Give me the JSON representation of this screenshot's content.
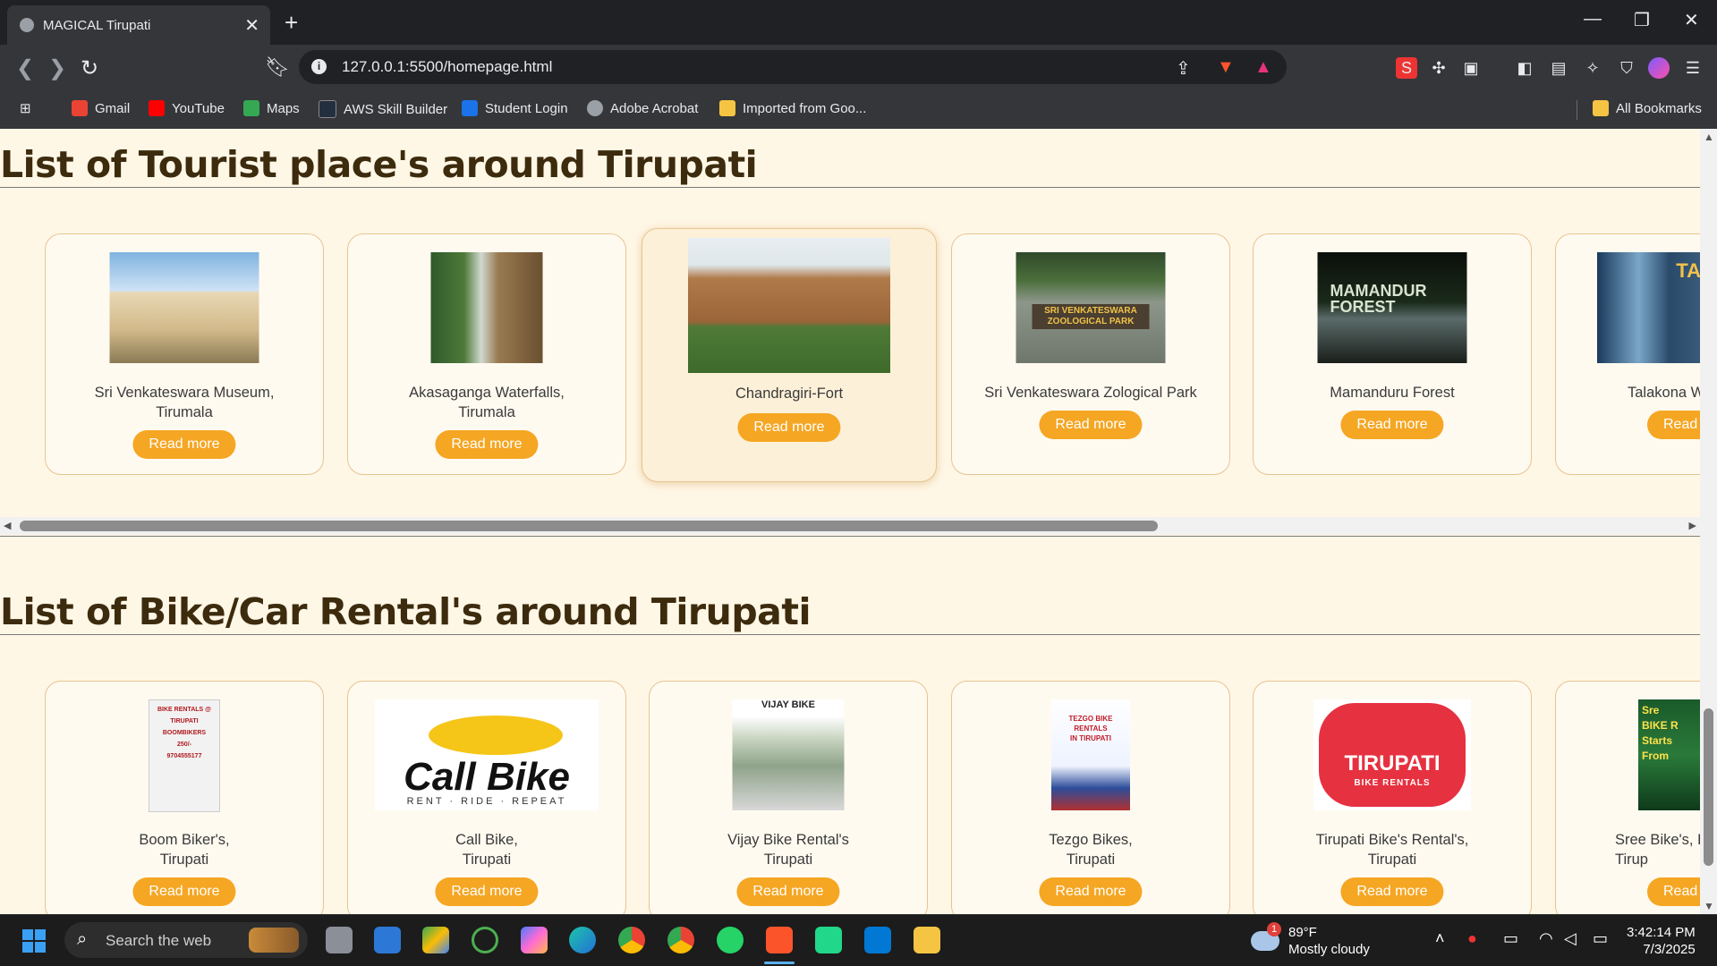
{
  "browser": {
    "tab_title": "MAGICAL Tirupati",
    "url": "127.0.0.1:5500/homepage.html",
    "bookmarks": [
      {
        "label": "Gmail",
        "color": "#ea4335"
      },
      {
        "label": "YouTube",
        "color": "#ff0000"
      },
      {
        "label": "Maps",
        "color": "#34a853"
      },
      {
        "label": "AWS Skill Builder",
        "color": "#232f3e"
      },
      {
        "label": "Student Login",
        "color": "#1a73e8"
      },
      {
        "label": "Adobe Acrobat",
        "color": "#9aa0a6"
      },
      {
        "label": "Imported from Goo...",
        "color": "#f6c443"
      }
    ],
    "all_bookmarks": "All Bookmarks"
  },
  "tourist": {
    "title": "List of Tourist place's around Tirupati",
    "cards": [
      {
        "name": "Sri Venkateswara Museum,\nTirumala",
        "button": "Read more"
      },
      {
        "name": "Akasaganga Waterfalls,\nTirumala",
        "button": "Read more"
      },
      {
        "name": "Chandragiri-Fort",
        "button": "Read more"
      },
      {
        "name": "Sri Venkateswara Zological Park",
        "button": "Read more"
      },
      {
        "name": "Mamanduru Forest",
        "button": "Read more"
      },
      {
        "name": "Talakona W",
        "button": "Read m"
      }
    ],
    "image_text": {
      "zoo": "SRI VENKATESWARA\nZOOLOGICAL PARK",
      "forest": "MAMANDUR\nFOREST",
      "talakona": "TA"
    }
  },
  "rental": {
    "title": "List of Bike/Car Rental's around Tirupati",
    "cards": [
      {
        "name": "Boom Biker's,\nTirupati",
        "button": "Read more"
      },
      {
        "name": "Call Bike,\nTirupati",
        "button": "Read more"
      },
      {
        "name": "Vijay Bike Rental's\nTirupati",
        "button": "Read more"
      },
      {
        "name": "Tezgo Bikes,\nTirupati",
        "button": "Read more"
      },
      {
        "name": "Tirupati Bike's Rental's,\nTirupati",
        "button": "Read more"
      },
      {
        "name": "Sree Bike's, Bi\nTirup",
        "button": "Read m"
      }
    ],
    "image_text": {
      "boom": "BIKE RENTALS @ TIRUPATI\nBOOMBIKERS\n250/-\n9704555177",
      "callbike_main": "Call Bike",
      "callbike_sub": "RENT · RIDE · REPEAT",
      "vijay": "VIJAY BIKE",
      "tezgo": "TEZGO BIKE RENTALS\nIN TIRUPATI",
      "tirupati_main": "TIRUPATI",
      "tirupati_sub": "BIKE RENTALS",
      "sree": "Sre\nBIKE R\nStarts From"
    }
  },
  "taskbar": {
    "search_placeholder": "Search the web",
    "weather_temp": "89°F",
    "weather_desc": "Mostly cloudy",
    "weather_badge": "1",
    "time": "3:42:14 PM",
    "date": "7/3/2025"
  }
}
